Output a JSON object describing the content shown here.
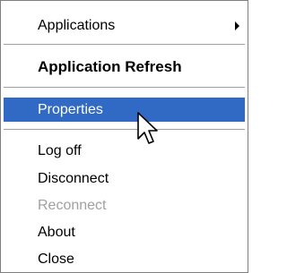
{
  "menu": {
    "items": [
      {
        "label": "Applications"
      },
      {
        "label": "Application Refresh"
      },
      {
        "label": "Properties"
      },
      {
        "label": "Log off"
      },
      {
        "label": "Disconnect"
      },
      {
        "label": "Reconnect"
      },
      {
        "label": "About"
      },
      {
        "label": "Close"
      }
    ]
  },
  "colors": {
    "highlight": "#316ac5",
    "disabled_text": "#a0a0a0",
    "separator": "#a0a0a0"
  },
  "icons": [
    "submenu-arrow-icon",
    "mouse-pointer-icon"
  ]
}
